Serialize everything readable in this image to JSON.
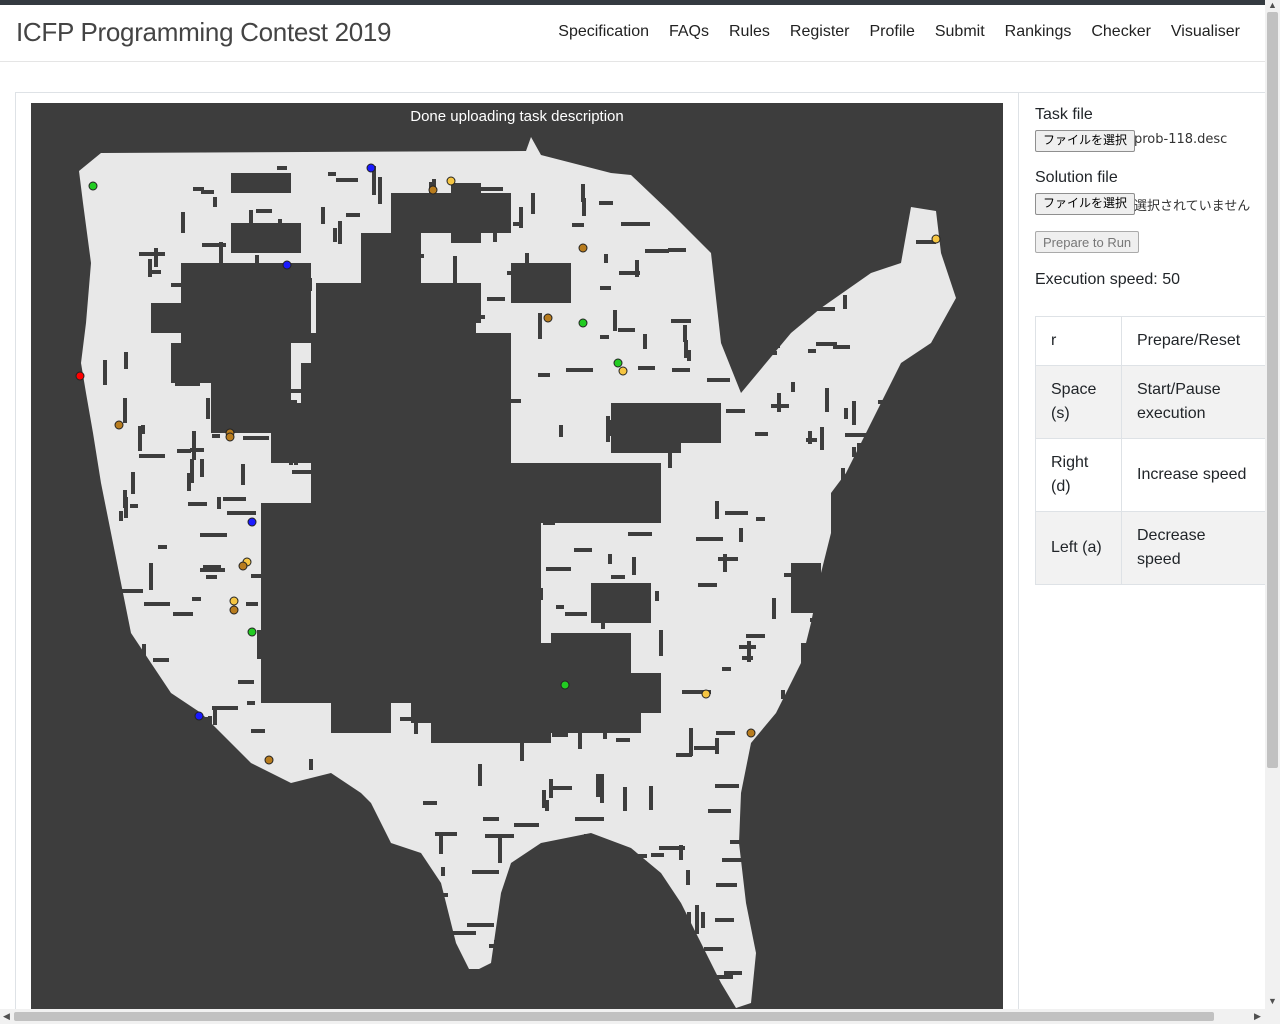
{
  "app": {
    "title": "ICFP Programming Contest 2019"
  },
  "nav": {
    "items": [
      "Specification",
      "FAQs",
      "Rules",
      "Register",
      "Profile",
      "Submit",
      "Rankings",
      "Checker",
      "Visualiser"
    ]
  },
  "visualiser": {
    "status_message": "Done uploading task description",
    "colors": {
      "background": "#3d3d3d",
      "land": "#e8e8e8",
      "wall": "#3d3d3d",
      "start": "#ff0000",
      "booster_yellow": "#f5c542",
      "booster_brown": "#b87c1e",
      "booster_green": "#22cc22",
      "booster_blue": "#1a1aff"
    }
  },
  "controls": {
    "task_label": "Task file",
    "task_button": "ファイルを選択",
    "task_filename": "prob-118.desc",
    "solution_label": "Solution file",
    "solution_button": "ファイルを選択",
    "solution_filename": "選択されていません",
    "prepare_button": "Prepare to Run",
    "speed_text": "Execution speed: 50"
  },
  "keybindings": [
    {
      "key": "r",
      "action": "Prepare/Reset"
    },
    {
      "key": "Space (s)",
      "action": "Start/Pause execution"
    },
    {
      "key": "Right (d)",
      "action": "Increase speed"
    },
    {
      "key": "Left (a)",
      "action": "Decrease speed"
    }
  ]
}
